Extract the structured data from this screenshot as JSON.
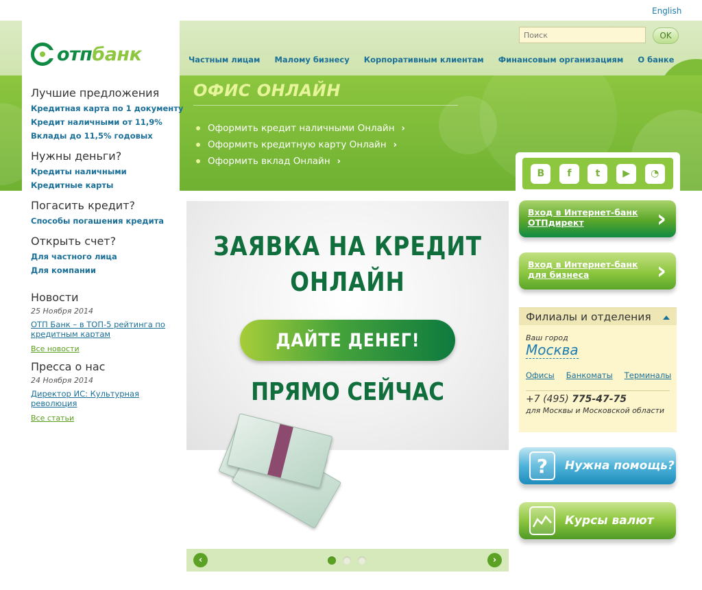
{
  "header": {
    "language_link": "English",
    "search_placeholder": "Поиск",
    "search_button": "OK"
  },
  "logo": {
    "part1": "отп",
    "part2": "банк"
  },
  "top_nav": [
    {
      "label": "Частным лицам"
    },
    {
      "label": "Малому бизнесу"
    },
    {
      "label": "Корпоративным клиентам"
    },
    {
      "label": "Финансовым организациям"
    },
    {
      "label": "О банке"
    }
  ],
  "left_menu": {
    "best": {
      "title": "Лучшие предложения",
      "links": [
        "Кредитная карта по 1 документу",
        "Кредит наличными от 11,9%",
        "Вклады до 11,5% годовых"
      ]
    },
    "money": {
      "title": "Нужны деньги?",
      "links": [
        "Кредиты наличными",
        "Кредитные карты"
      ]
    },
    "repay": {
      "title": "Погасить кредит?",
      "links": [
        "Способы погашения кредита"
      ]
    },
    "account": {
      "title": "Открыть счет?",
      "links": [
        "Для частного лица",
        "Для компании"
      ]
    },
    "news": {
      "title": "Новости",
      "date": "25 Ноября 2014",
      "link": "ОТП Банк – в ТОП-5 рейтинга по кредитным картам",
      "all": "Все новости"
    },
    "press": {
      "title": "Пресса о нас",
      "date": "24 Ноября 2014",
      "link": "Директор ИС: Культурная революция",
      "all": "Все статьи"
    }
  },
  "office_online": {
    "title": "ОФИС ОНЛАЙН",
    "items": [
      "Оформить кредит наличными Онлайн",
      "Оформить кредитную карту Онлайн",
      "Оформить вклад Онлайн"
    ]
  },
  "social": [
    {
      "icon": "vk-icon",
      "glyph": "B"
    },
    {
      "icon": "facebook-icon",
      "glyph": "f"
    },
    {
      "icon": "twitter-icon",
      "glyph": "t"
    },
    {
      "icon": "youtube-icon",
      "glyph": "▶"
    },
    {
      "icon": "rss-icon",
      "glyph": "◔"
    }
  ],
  "banner": {
    "line1": "ЗАЯВКА НА КРЕДИТ",
    "line2": "ОНЛАЙН",
    "button": "ДАЙТЕ ДЕНЕГ!",
    "line3": "ПРЯМО СЕЙЧАС"
  },
  "carousel": {
    "slides": 3,
    "active": 1
  },
  "internet_bank": {
    "direct": "Вход в Интернет-банк ОТПдирект",
    "business": "Вход в Интернет-банк для бизнеса"
  },
  "branches": {
    "title": "Филиалы и отделения",
    "city_label": "Ваш город",
    "city": "Москва",
    "links": [
      "Офисы",
      "Банкоматы",
      "Терминалы"
    ],
    "phone_prefix": "+7 (495) ",
    "phone_number": "775-47-75",
    "phone_note": "для Москвы и Московской области"
  },
  "help_button": "Нужна помощь?",
  "rates_button": "Курсы валют",
  "colors": {
    "brand_green": "#0f8a43",
    "light_green": "#8dc63f",
    "link_blue": "#1a6f98"
  }
}
